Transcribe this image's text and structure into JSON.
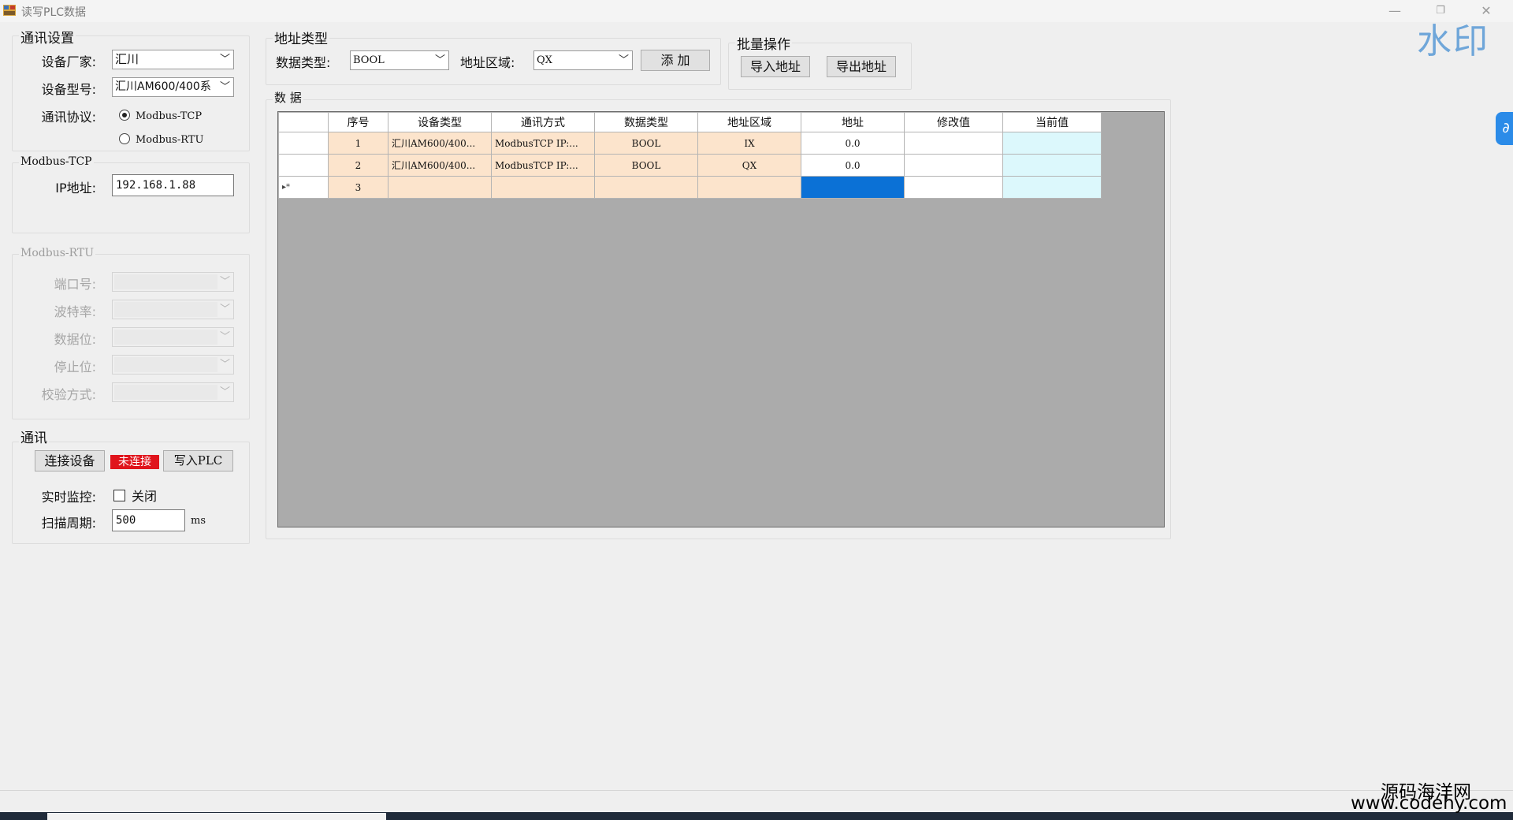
{
  "window": {
    "title": "读写PLC数据",
    "minimize_glyph": "—",
    "restore_glyph": "❐",
    "close_glyph": "✕",
    "watermark": "水印",
    "side_button_glyph": "∂"
  },
  "comm_settings": {
    "title": "通讯设置",
    "vendor_label": "设备厂家:",
    "vendor_value": "汇川",
    "model_label": "设备型号:",
    "model_value": "汇川AM600/400系",
    "protocol_label": "通讯协议:",
    "protocol_options": [
      "Modbus-TCP",
      "Modbus-RTU"
    ],
    "protocol_selected": "Modbus-TCP"
  },
  "modbus_tcp": {
    "title": "Modbus-TCP",
    "ip_label": "IP地址:",
    "ip_value": "192.168.1.88"
  },
  "modbus_rtu": {
    "title": "Modbus-RTU",
    "port_label": "端口号:",
    "baud_label": "波特率:",
    "databits_label": "数据位:",
    "stopbits_label": "停止位:",
    "parity_label": "校验方式:"
  },
  "comm": {
    "title": "通讯",
    "connect_label": "连接设备",
    "status_text": "未连接",
    "status_color": "#e0141c",
    "write_label": "写入PLC",
    "monitor_label": "实时监控:",
    "monitor_checkbox_label": "关闭",
    "monitor_checked": false,
    "scan_label": "扫描周期:",
    "scan_value": "500",
    "scan_unit": "ms"
  },
  "address_type": {
    "title": "地址类型",
    "datatype_label": "数据类型:",
    "datatype_value": "BOOL",
    "area_label": "地址区域:",
    "area_value": "QX",
    "add_label": "添 加"
  },
  "batch": {
    "title": "批量操作",
    "import_label": "导入地址",
    "export_label": "导出地址"
  },
  "data_grid": {
    "title": "数 据",
    "columns": [
      "序号",
      "设备类型",
      "通讯方式",
      "数据类型",
      "地址区域",
      "地址",
      "修改值",
      "当前值"
    ],
    "rows": [
      {
        "marker": "",
        "index": "1",
        "device": "汇川AM600/400...",
        "comm": "ModbusTCP IP:...",
        "dtype": "BOOL",
        "area": "IX",
        "address": "0.0",
        "modify": "",
        "current": ""
      },
      {
        "marker": "",
        "index": "2",
        "device": "汇川AM600/400...",
        "comm": "ModbusTCP IP:...",
        "dtype": "BOOL",
        "area": "QX",
        "address": "0.0",
        "modify": "",
        "current": ""
      },
      {
        "marker": "▸*",
        "index": "3",
        "device": "",
        "comm": "",
        "dtype": "",
        "area": "",
        "address": "",
        "modify": "",
        "current": ""
      }
    ],
    "peach_color": "#fce4cc",
    "current_value_color": "#dcf8fc",
    "selected_color": "#0b71d6"
  },
  "site_watermark": {
    "line1": "源码海洋网",
    "line2": "www.codehy.com"
  }
}
